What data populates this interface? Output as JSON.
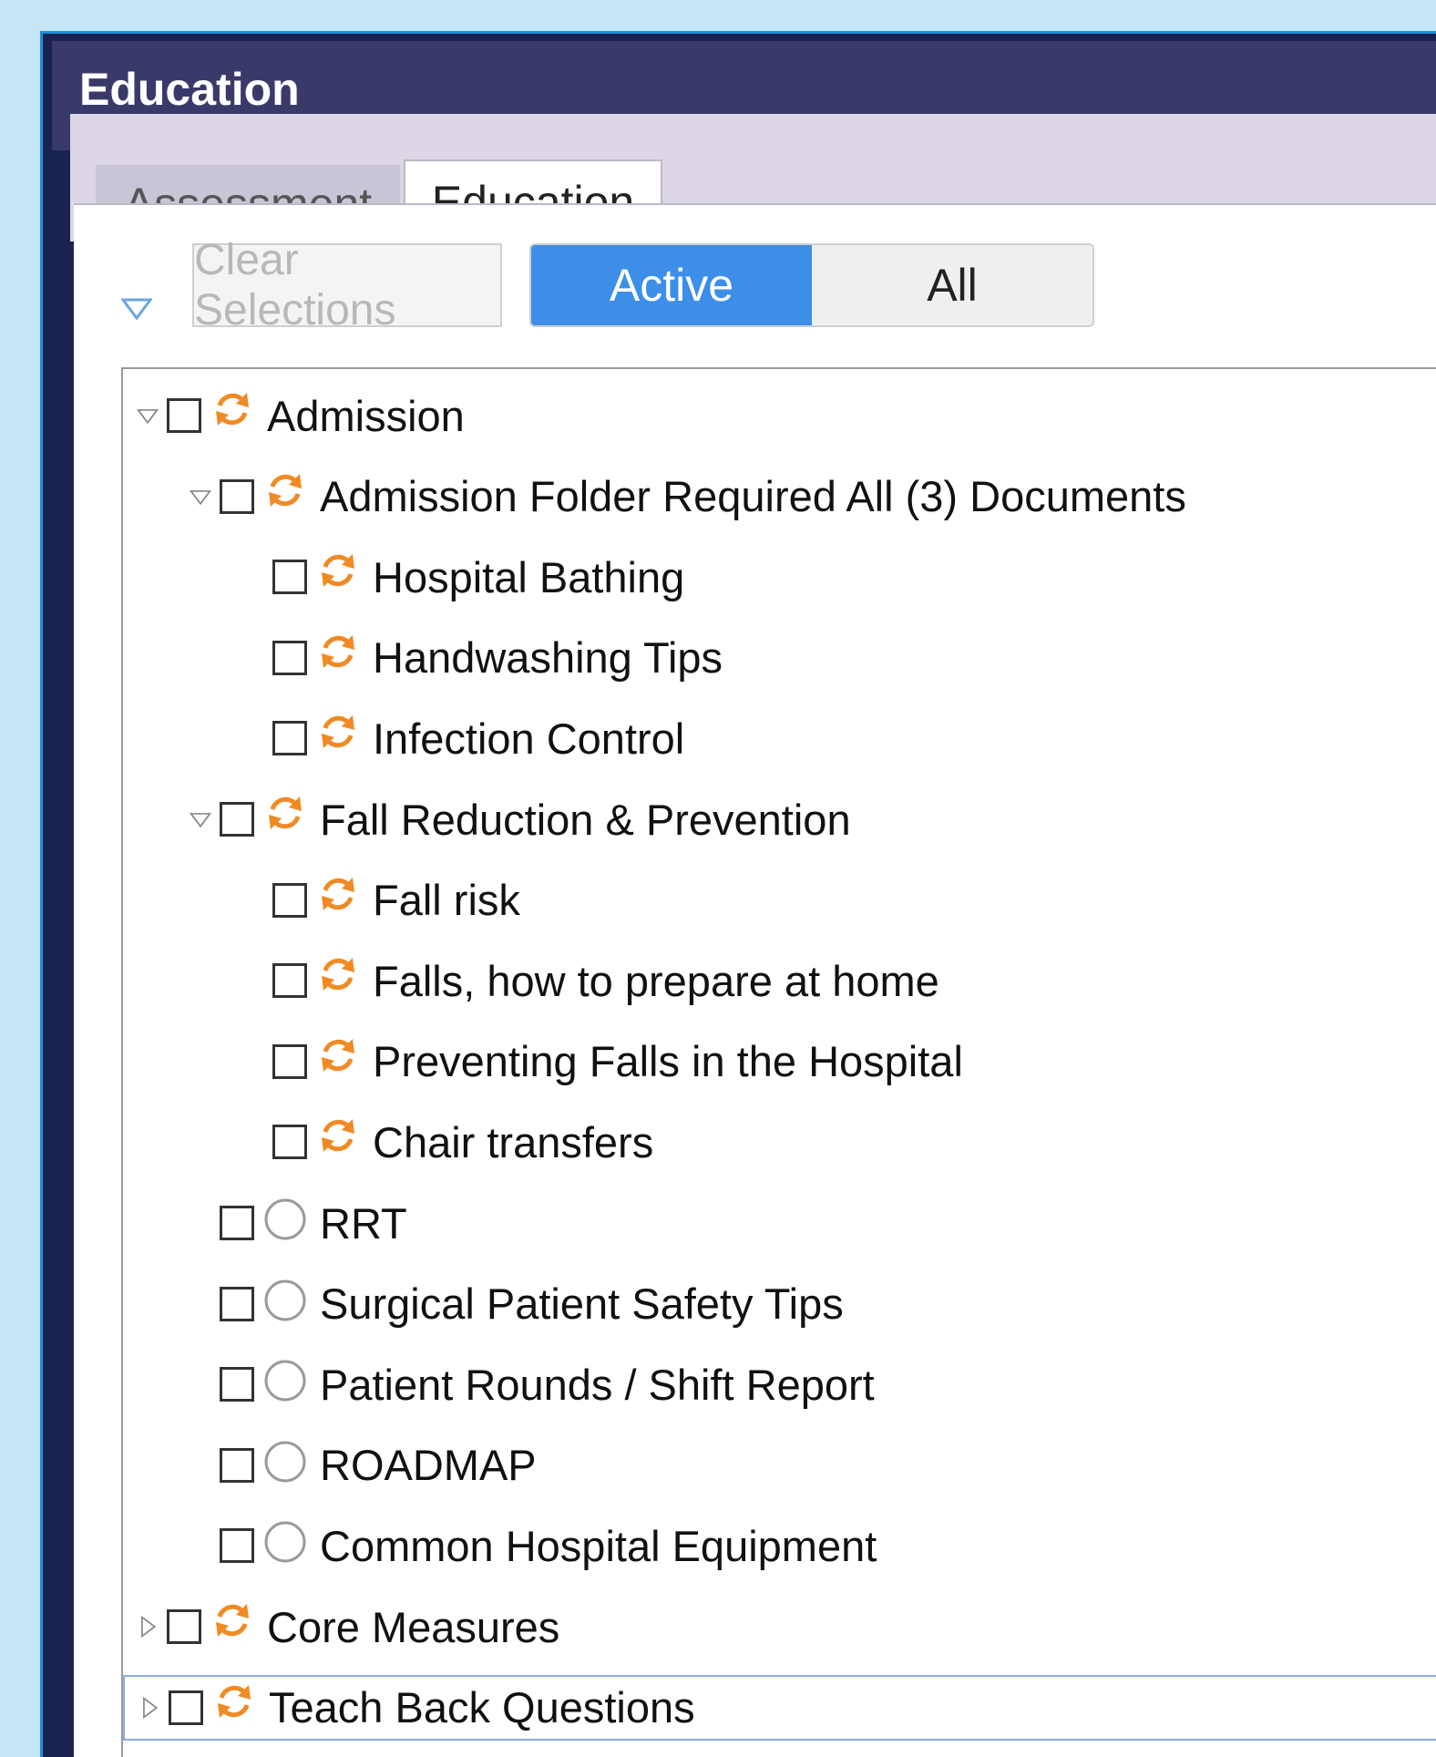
{
  "window": {
    "title": "Education"
  },
  "tabs": [
    {
      "label": "Assessment",
      "active": false
    },
    {
      "label": "Education",
      "active": true
    }
  ],
  "toolbar": {
    "filter_icon": "filter-down-triangle-icon",
    "clear_label": "Clear Selections",
    "segment": {
      "active_label": "Active",
      "all_label": "All",
      "selected": "Active"
    }
  },
  "colors": {
    "accent": "#3d8ee8",
    "refresh_icon": "#f08a24",
    "titlebar": "#3a3a6a"
  },
  "tree": [
    {
      "label": "Admission",
      "level": 0,
      "expander": "expanded",
      "icon": "refresh-icon",
      "checked": false
    },
    {
      "label": "Admission Folder Required All (3) Documents",
      "level": 1,
      "expander": "expanded",
      "icon": "refresh-icon",
      "checked": false
    },
    {
      "label": "Hospital Bathing",
      "level": 2,
      "expander": "none",
      "icon": "refresh-icon",
      "checked": false
    },
    {
      "label": "Handwashing Tips",
      "level": 2,
      "expander": "none",
      "icon": "refresh-icon",
      "checked": false
    },
    {
      "label": "Infection Control",
      "level": 2,
      "expander": "none",
      "icon": "refresh-icon",
      "checked": false
    },
    {
      "label": "Fall Reduction & Prevention",
      "level": 1,
      "expander": "expanded",
      "icon": "refresh-icon",
      "checked": false
    },
    {
      "label": "Fall risk",
      "level": 2,
      "expander": "none",
      "icon": "refresh-icon",
      "checked": false
    },
    {
      "label": "Falls, how to prepare at home",
      "level": 2,
      "expander": "none",
      "icon": "refresh-icon",
      "checked": false
    },
    {
      "label": "Preventing Falls in the Hospital",
      "level": 2,
      "expander": "none",
      "icon": "refresh-icon",
      "checked": false
    },
    {
      "label": "Chair transfers",
      "level": 2,
      "expander": "none",
      "icon": "refresh-icon",
      "checked": false
    },
    {
      "label": "RRT",
      "level": 1,
      "expander": "none",
      "icon": "circle-icon",
      "checked": false
    },
    {
      "label": "Surgical Patient Safety Tips",
      "level": 1,
      "expander": "none",
      "icon": "circle-icon",
      "checked": false
    },
    {
      "label": "Patient Rounds / Shift Report",
      "level": 1,
      "expander": "none",
      "icon": "circle-icon",
      "checked": false
    },
    {
      "label": "ROADMAP",
      "level": 1,
      "expander": "none",
      "icon": "circle-icon",
      "checked": false
    },
    {
      "label": "Common Hospital Equipment",
      "level": 1,
      "expander": "none",
      "icon": "circle-icon",
      "checked": false
    },
    {
      "label": "Core Measures",
      "level": 0,
      "expander": "collapsed",
      "icon": "refresh-icon",
      "checked": false
    },
    {
      "label": "Teach Back Questions",
      "level": 0,
      "expander": "collapsed",
      "icon": "refresh-icon",
      "checked": false,
      "focused": true
    }
  ]
}
